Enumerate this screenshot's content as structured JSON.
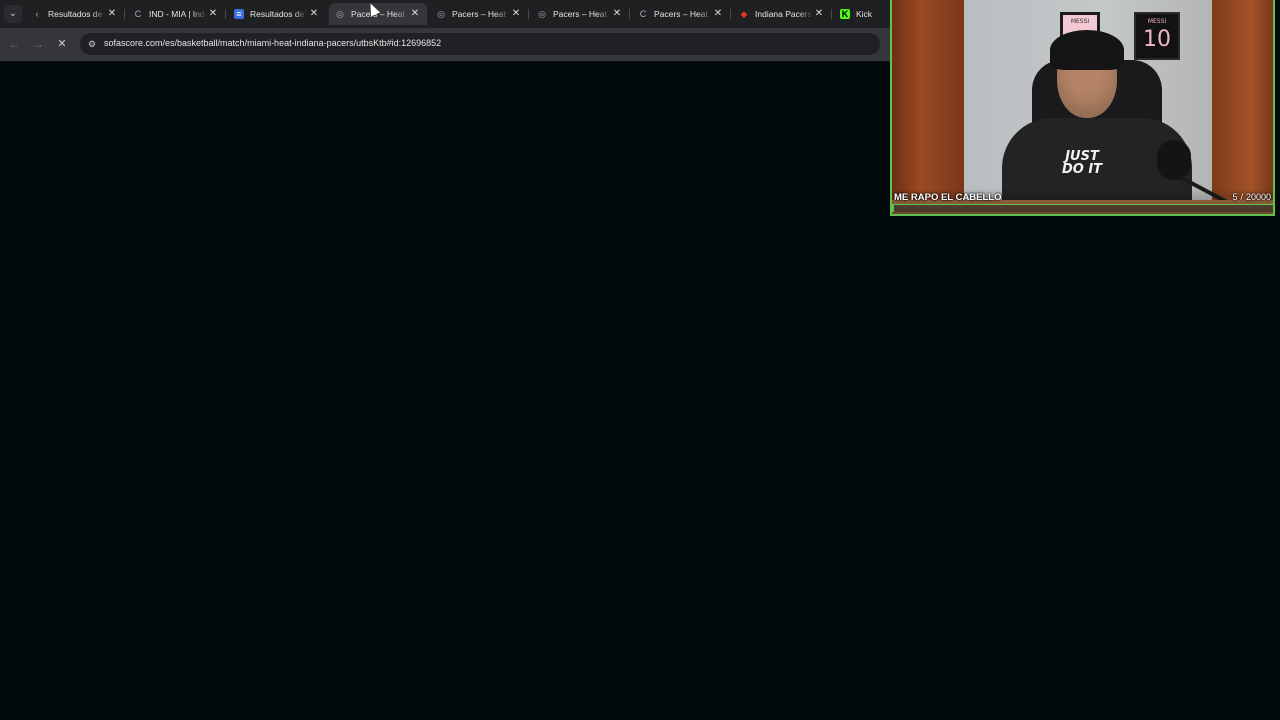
{
  "browser": {
    "tabs": [
      {
        "title": "Resultados de",
        "favicon": "chevron-left-icon",
        "active": false
      },
      {
        "title": "IND - MIA | Ind",
        "favicon": "c-logo-icon",
        "active": false
      },
      {
        "title": "Resultados de",
        "favicon": "blue-square-icon",
        "active": false
      },
      {
        "title": "Pacers – Heat",
        "favicon": "spiral-icon",
        "active": true
      },
      {
        "title": "Pacers – Heat",
        "favicon": "spiral-icon",
        "active": false
      },
      {
        "title": "Pacers – Heat",
        "favicon": "spiral-icon",
        "active": false
      },
      {
        "title": "Pacers – Heat",
        "favicon": "c-logo-icon",
        "active": false
      },
      {
        "title": "Indiana Pacers",
        "favicon": "red-logo-icon",
        "active": false
      },
      {
        "title": "Kick",
        "favicon": "kick-icon",
        "active": false
      }
    ],
    "url": "sofascore.com/es/basketball/match/miami-heat-indiana-pacers/utbsKtb#id:12696852",
    "loading": true
  },
  "webcam": {
    "frame_1_text": "MESSI",
    "frame_2_text": "MESSI",
    "frame_2_number": "10",
    "shirt_line_1": "JUST",
    "shirt_line_2": "DO IT",
    "goal_label": "ME RAPO EL CABELLO",
    "goal_current": "5",
    "goal_separator": "/",
    "goal_target": "20000",
    "goal_progress": 0.00025,
    "accent_color": "#5fc24c"
  }
}
